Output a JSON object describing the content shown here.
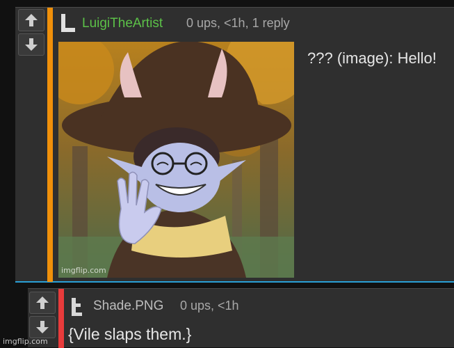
{
  "comments": [
    {
      "username": "LuigiTheArtist",
      "meta": "0 ups, <1h, 1 reply",
      "text": "??? (image): Hello!",
      "image_watermark": "imgflip.com",
      "stripe_color": "#f0900a",
      "username_color": "#5cc148"
    },
    {
      "username": "Shade.PNG",
      "meta": "0 ups, <1h",
      "text": "{Vile slaps them.}",
      "stripe_color": "#e83b3b",
      "username_color": "#bdbdbd"
    }
  ],
  "icons": {
    "upvote": "arrow-up-icon",
    "downvote": "arrow-down-icon",
    "avatar1": "letter-l-avatar-icon",
    "avatar2": "letter-t-avatar-icon"
  },
  "page_watermark": "imgflip.com"
}
